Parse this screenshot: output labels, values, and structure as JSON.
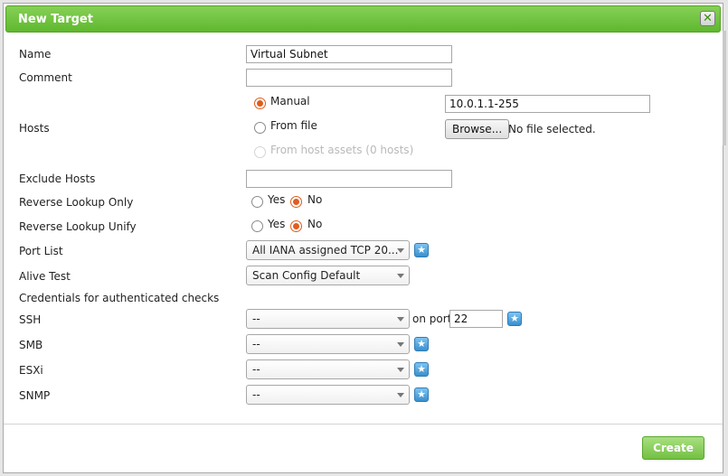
{
  "dialog": {
    "title": "New Target",
    "close_icon": "close-x-icon",
    "colors": {
      "title_bar": "#6cc23a",
      "create_button": "#84cc52",
      "radio_checked": "#e05c1e",
      "star_button": "#4a9fdb"
    }
  },
  "form": {
    "name": {
      "label": "Name",
      "value": "Virtual Subnet"
    },
    "comment": {
      "label": "Comment",
      "value": ""
    },
    "hosts": {
      "label": "Hosts",
      "manual": {
        "label": "Manual",
        "selected": true,
        "value": "10.0.1.1-255"
      },
      "from_file": {
        "label": "From file",
        "selected": false,
        "browse_label": "Browse...",
        "file_status": "No file selected."
      },
      "from_assets": {
        "label": "From host assets (0 hosts)",
        "disabled": true
      }
    },
    "exclude_hosts": {
      "label": "Exclude Hosts",
      "value": ""
    },
    "reverse_lookup_only": {
      "label": "Reverse Lookup Only",
      "yes": "Yes",
      "no": "No",
      "selected": "No"
    },
    "reverse_lookup_unify": {
      "label": "Reverse Lookup Unify",
      "yes": "Yes",
      "no": "No",
      "selected": "No"
    },
    "port_list": {
      "label": "Port List",
      "selected": "All IANA assigned TCP 20...",
      "new_icon": "star-icon"
    },
    "alive_test": {
      "label": "Alive Test",
      "selected": "Scan Config Default"
    },
    "credentials_heading": "Credentials for authenticated checks",
    "ssh": {
      "label": "SSH",
      "selected": "--",
      "on_port_label": "on port",
      "port": "22"
    },
    "smb": {
      "label": "SMB",
      "selected": "--"
    },
    "esxi": {
      "label": "ESXi",
      "selected": "--"
    },
    "snmp": {
      "label": "SNMP",
      "selected": "--"
    }
  },
  "footer": {
    "create_label": "Create"
  }
}
